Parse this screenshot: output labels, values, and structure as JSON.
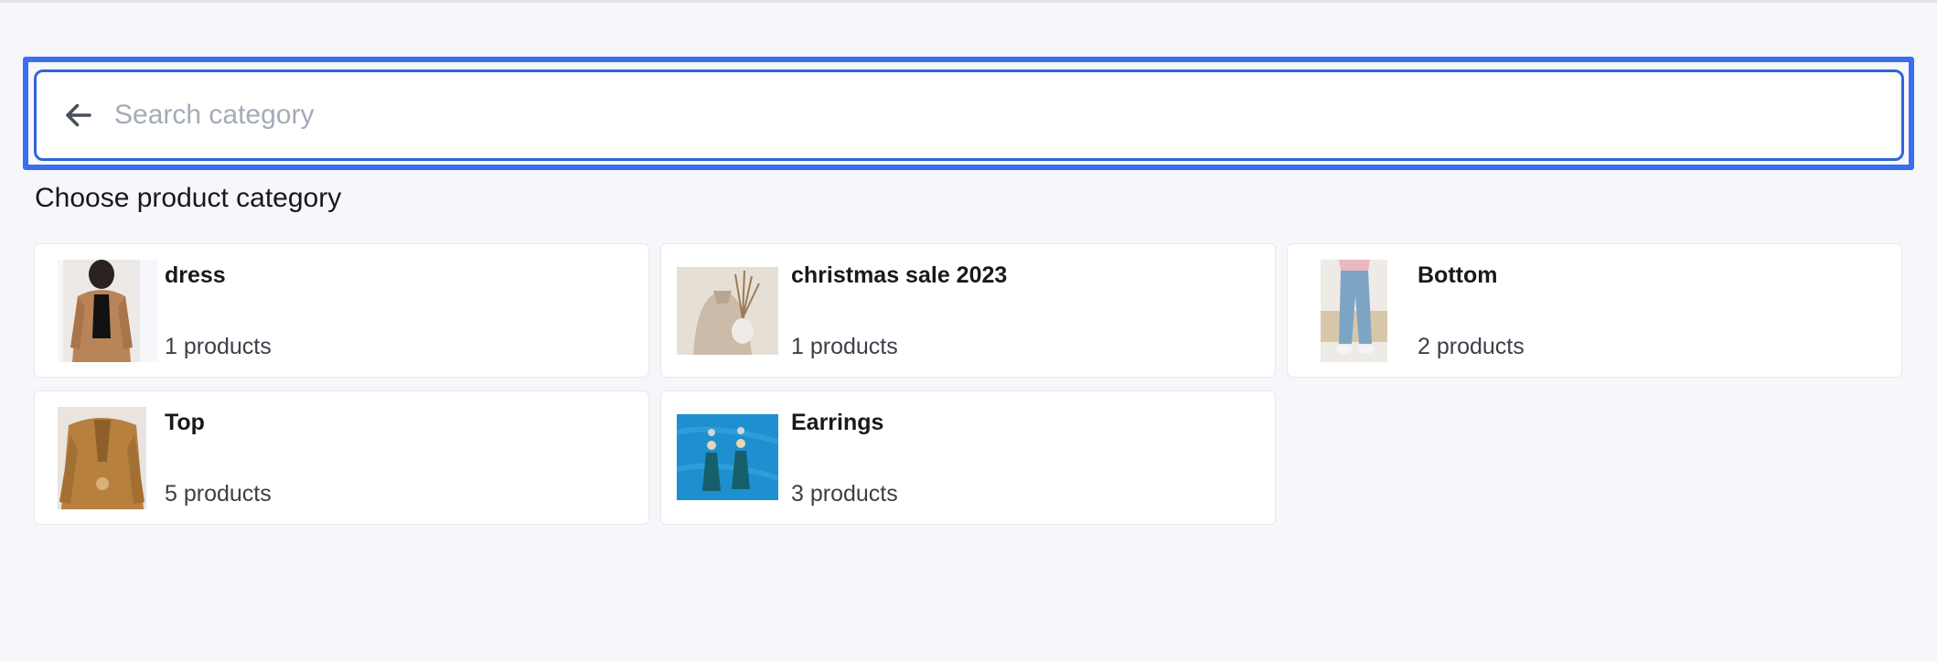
{
  "search": {
    "placeholder": "Search category",
    "value": "",
    "back_icon": "arrow-left-icon"
  },
  "section_title": "Choose product category",
  "colors": {
    "focus_ring": "#3a6fef",
    "input_border": "#2f65d9",
    "page_background": "#f6f7fa"
  },
  "categories": [
    {
      "name": "dress",
      "count": "1 products",
      "thumbnail": "woman-in-tan-blazer-photo"
    },
    {
      "name": "christmas sale 2023",
      "count": "1 products",
      "thumbnail": "woman-holding-vase-with-dried-grass-photo"
    },
    {
      "name": "Bottom",
      "count": "2 products",
      "thumbnail": "jeans-and-sneakers-photo"
    },
    {
      "name": "Top",
      "count": "5 products",
      "thumbnail": "mustard-knit-cardigan-photo"
    },
    {
      "name": "Earrings",
      "count": "3 products",
      "thumbnail": "beaded-tassel-earrings-photo"
    }
  ]
}
